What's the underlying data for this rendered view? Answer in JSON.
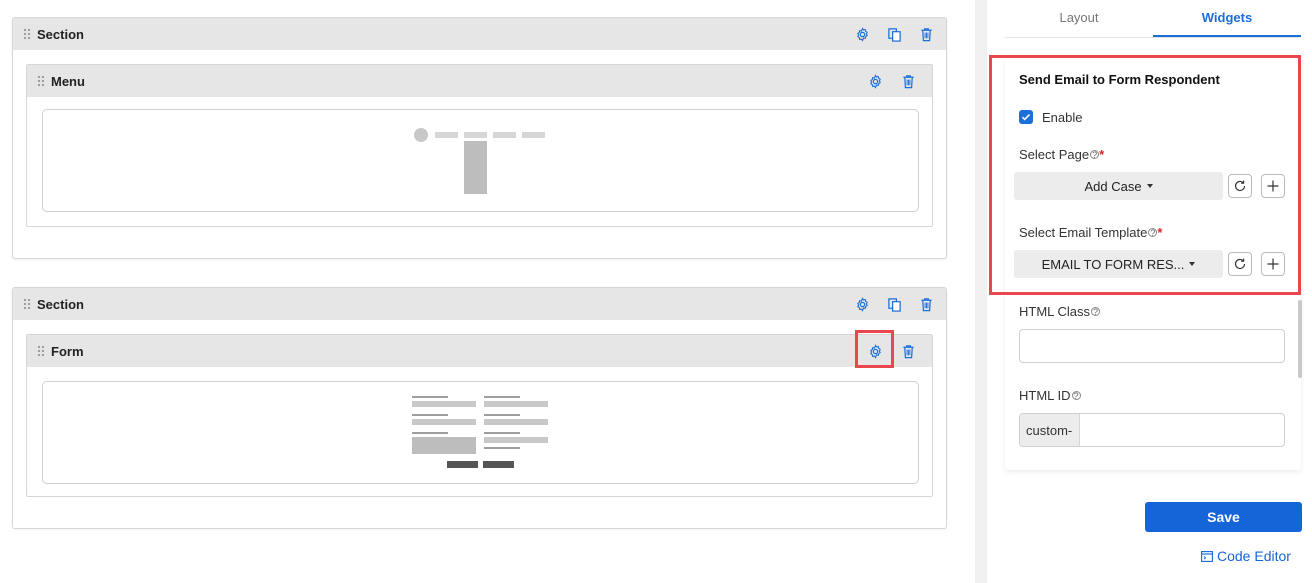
{
  "sections": [
    {
      "title": "Section",
      "widget": {
        "title": "Menu"
      }
    },
    {
      "title": "Section",
      "widget": {
        "title": "Form"
      }
    }
  ],
  "panel": {
    "tabs": [
      "Layout",
      "Widgets"
    ],
    "active_tab": "Widgets",
    "heading": "Send Email to Form Respondent",
    "enable_label": "Enable",
    "enable_checked": true,
    "select_page_label": "Select Page",
    "select_page_value": "Add Case",
    "select_template_label": "Select Email Template",
    "select_template_value": "EMAIL TO FORM RES...",
    "required_mark": "*",
    "html_class_label": "HTML Class",
    "html_class_value": "",
    "html_id_label": "HTML ID",
    "html_id_prefix": "custom-",
    "html_id_value": "",
    "save_label": "Save",
    "code_editor_label": "Code Editor"
  },
  "colors": {
    "accent": "#1565d8",
    "highlight": "#e8474b",
    "icon": "#1b6fd8"
  },
  "icons": [
    "drag-handle-icon",
    "gear-icon",
    "copy-icon",
    "trash-icon",
    "help-icon",
    "check-icon",
    "refresh-icon",
    "plus-icon",
    "code-editor-icon"
  ]
}
